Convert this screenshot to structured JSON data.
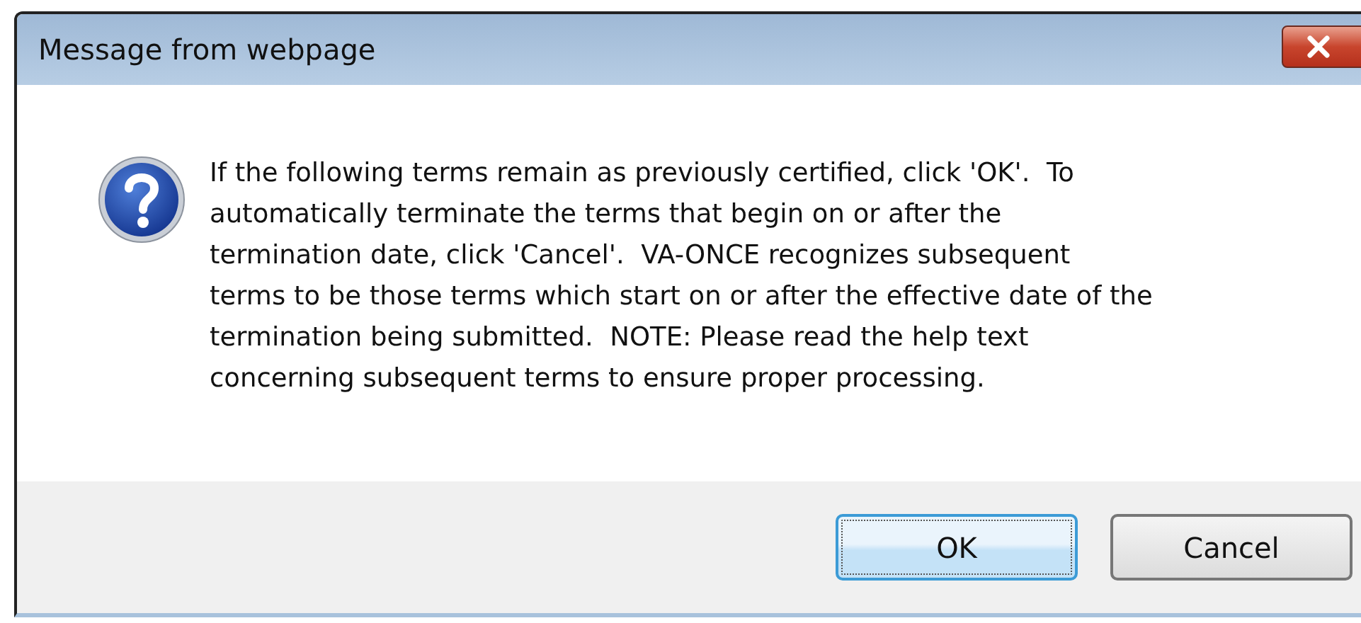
{
  "window": {
    "title": "Message from webpage"
  },
  "message": {
    "lines": [
      "If the following terms remain as previously certified, click 'OK'.  To",
      "automatically terminate the terms that begin on or after the",
      "termination date, click 'Cancel'.  VA-ONCE recognizes subsequent",
      "terms to be those terms which start on or after the effective date of the",
      "termination being submitted.  NOTE: Please read the help text",
      "concerning subsequent terms to ensure proper processing."
    ]
  },
  "buttons": [
    {
      "label": "OK",
      "focused": true
    },
    {
      "label": "Cancel",
      "focused": false
    }
  ]
}
